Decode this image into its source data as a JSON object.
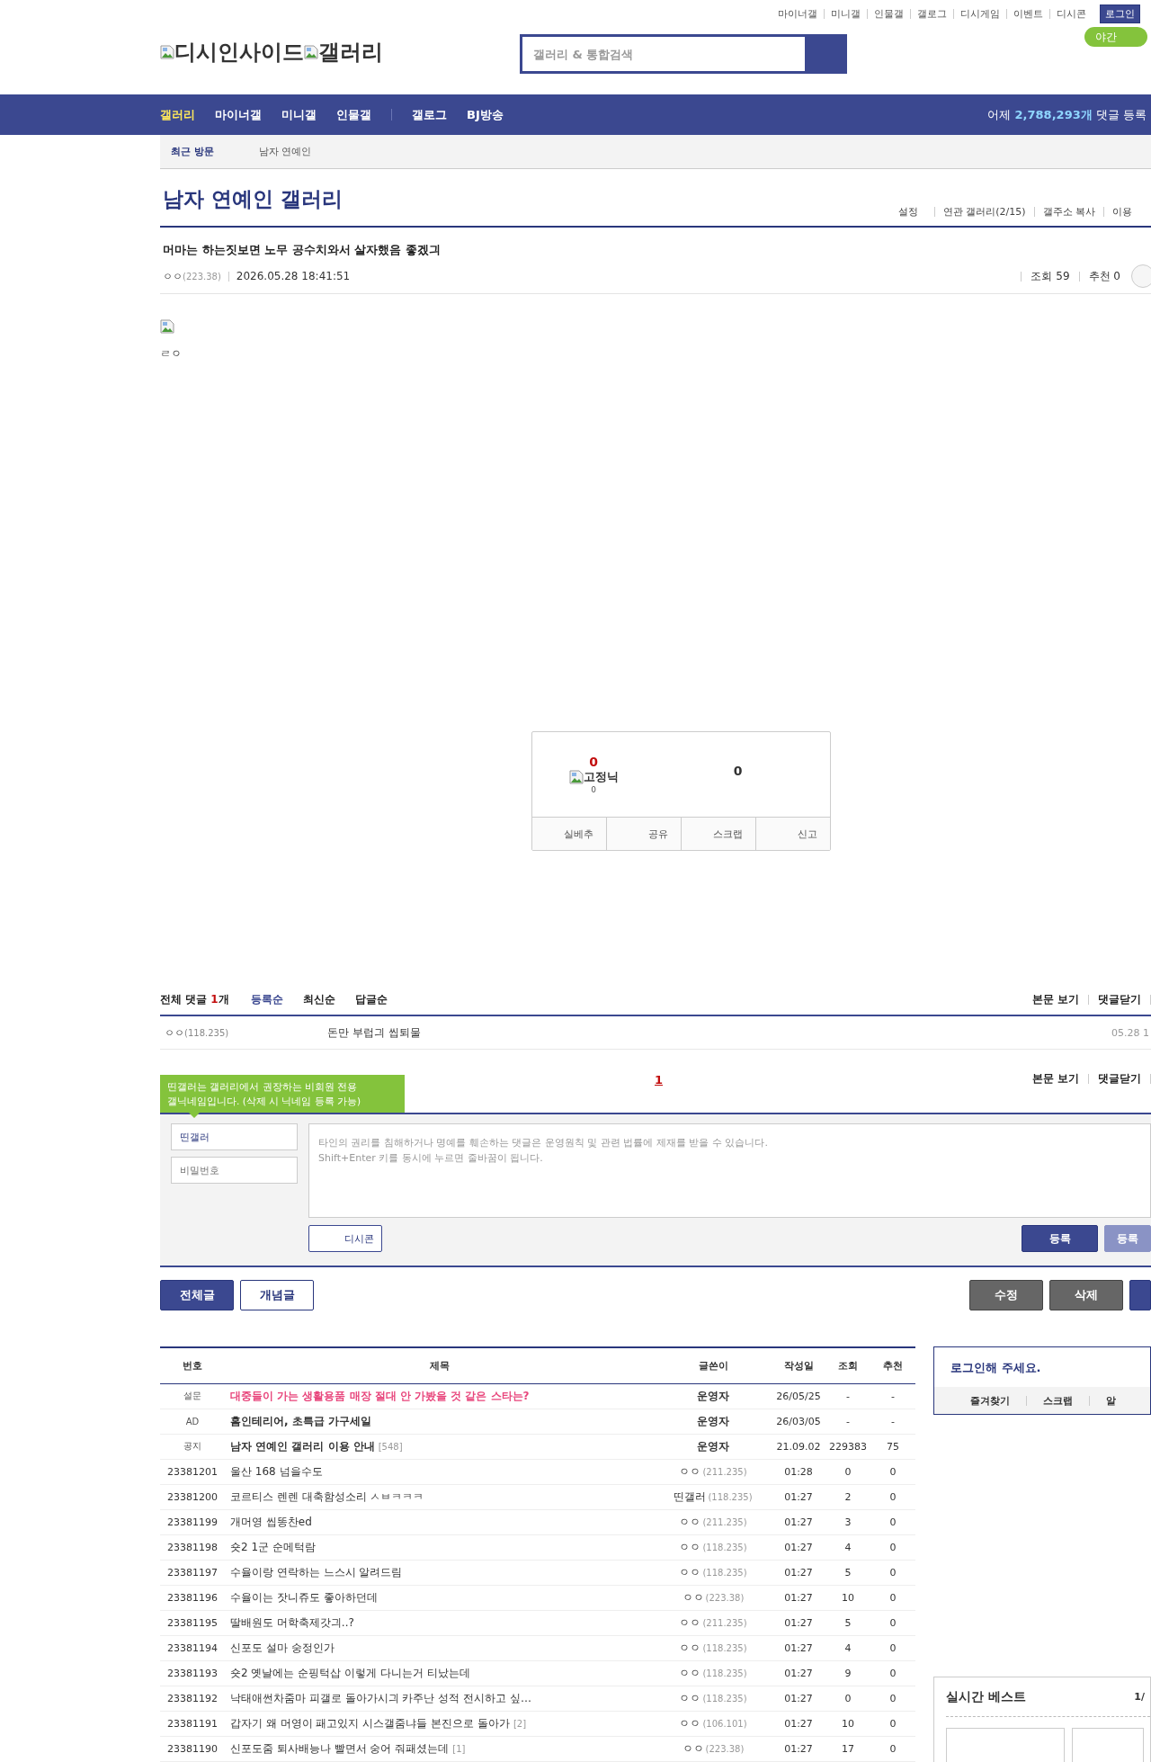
{
  "top_links": [
    "마이너갤",
    "미니갤",
    "인물갤",
    "갤로그",
    "디시게임",
    "이벤트",
    "디시콘"
  ],
  "login_button": "로그인",
  "night_mode_button": "야간",
  "logo": {
    "parts": [
      "디시인사이드",
      "갤러리"
    ]
  },
  "search": {
    "placeholder": "갤러리 & 통합검색"
  },
  "nav": {
    "groups": [
      [
        {
          "label": "갤러리",
          "selected": true
        },
        {
          "label": "마이너갤",
          "selected": false
        },
        {
          "label": "미니갤",
          "selected": false
        },
        {
          "label": "인물갤",
          "selected": false
        }
      ],
      [
        {
          "label": "갤로그",
          "selected": false
        },
        {
          "label": "BJ방송",
          "selected": false
        }
      ]
    ],
    "stats": {
      "prefix": "어제",
      "count": "2,788,293개",
      "suffix": "댓글 등록"
    }
  },
  "recent": {
    "label": "최근 방문",
    "items": [
      "남자 연예인"
    ]
  },
  "gallery": {
    "title": "남자 연예인 갤러리",
    "links": [
      "설정",
      "연관 갤러리(2/15)",
      "갤주소 복사",
      "이용"
    ]
  },
  "post": {
    "title": "머마는 하는짓보면 노무 공수치와서 살자했음 좋겠긔",
    "author": "ㅇㅇ",
    "ip": "(223.38)",
    "date": "2026.05.28 18:41:51",
    "views": "조회 59",
    "recommends": "추천 0",
    "body": "ㄹㅇ"
  },
  "vote": {
    "up_count": "0",
    "fixed_nick_label": "고정닉",
    "fixed_nick_count": "0",
    "down_count": "0",
    "actions": [
      "실베추",
      "공유",
      "스크랩",
      "신고"
    ]
  },
  "comments": {
    "total_label": "전체 댓글",
    "count": "1",
    "count_unit": "개",
    "sorts": [
      {
        "label": "등록순",
        "selected": true
      },
      {
        "label": "최신순",
        "selected": false
      },
      {
        "label": "답글순",
        "selected": false
      }
    ],
    "links": [
      "본문 보기",
      "댓글닫기"
    ],
    "items": [
      {
        "author": "ㅇㅇ",
        "ip": "(118.235)",
        "text": "돈만 부럽긔 씹퇴물",
        "date": "05.28 1"
      }
    ],
    "pages": [
      {
        "label": "1",
        "selected": true
      }
    ],
    "bottom_links": [
      "본문 보기",
      "댓글닫기"
    ]
  },
  "comment_form": {
    "tooltip": "띤갤러는 갤러리에서 권장하는 비회원 전용 갤닉네임입니다. (삭제 시 닉네임 등록 가능)",
    "nickname": "띤갤러",
    "password_placeholder": "비밀번호",
    "text_placeholder": "타인의 권리를 침해하거나 명예를 훼손하는 댓글은 운영원칙 및 관련 법률에 제재를 받을 수 있습니다.\nShift+Enter 키를 동시에 누르면 줄바꿈이 됩니다.",
    "dccon_button": "디시콘",
    "submit_buttons": [
      "등록",
      "등록"
    ]
  },
  "list_buttons": {
    "left": [
      {
        "label": "전체글",
        "selected": true
      },
      {
        "label": "개념글",
        "selected": false
      }
    ],
    "right": [
      "수정",
      "삭제"
    ]
  },
  "table": {
    "columns": [
      "번호",
      "제목",
      "글쓴이",
      "작성일",
      "조회",
      "추천"
    ],
    "rows": [
      {
        "kind": "survey",
        "number": "설문",
        "title": "대중들이 가는 생활용품 매장 절대 안 가봤을 것 같은 스타는?",
        "author": "운영자",
        "date": "26/05/25",
        "views": "-",
        "recommends": "-"
      },
      {
        "kind": "ad",
        "number": "AD",
        "title": "홈인테리어, 초특급 가구세일",
        "author": "운영자",
        "date": "26/03/05",
        "views": "-",
        "recommends": "-"
      },
      {
        "kind": "notice",
        "number": "공지",
        "title": "남자 연예인 갤러리 이용 안내",
        "comment_count": "[548]",
        "author": "운영자",
        "date": "21.09.02",
        "views": "229383",
        "recommends": "75"
      },
      {
        "kind": "post",
        "number": "23381201",
        "title": "울산 168 넘을수도",
        "author": "ㅇㅇ",
        "ip": "(211.235)",
        "date": "01:28",
        "views": "0",
        "recommends": "0"
      },
      {
        "kind": "post",
        "number": "23381200",
        "title": "코르티스 렌렌 대축함성소리 ㅅㅂㅋㅋㅋ",
        "author": "띤갤러",
        "ip": "(118.235)",
        "date": "01:27",
        "views": "2",
        "recommends": "0"
      },
      {
        "kind": "post",
        "number": "23381199",
        "title": "개머영 씹똥찬ed",
        "author": "ㅇㅇ",
        "ip": "(211.235)",
        "date": "01:27",
        "views": "3",
        "recommends": "0"
      },
      {
        "kind": "post",
        "number": "23381198",
        "title": "숏2 1군 순메턱람",
        "author": "ㅇㅇ",
        "ip": "(118.235)",
        "date": "01:27",
        "views": "4",
        "recommends": "0"
      },
      {
        "kind": "post",
        "number": "23381197",
        "title": "수율이랑 연락하는 느스시 알려드림",
        "author": "ㅇㅇ",
        "ip": "(118.235)",
        "date": "01:27",
        "views": "5",
        "recommends": "0"
      },
      {
        "kind": "post",
        "number": "23381196",
        "title": "수율이는 잣니쥬도 좋아하던데",
        "author": "ㅇㅇ",
        "ip": "(223.38)",
        "date": "01:27",
        "views": "10",
        "recommends": "0"
      },
      {
        "kind": "post",
        "number": "23381195",
        "title": "딸배원도 머학축제갓긔..?",
        "author": "ㅇㅇ",
        "ip": "(211.235)",
        "date": "01:27",
        "views": "5",
        "recommends": "0"
      },
      {
        "kind": "post",
        "number": "23381194",
        "title": "신포도 설마 숭정인가",
        "author": "ㅇㅇ",
        "ip": "(118.235)",
        "date": "01:27",
        "views": "4",
        "recommends": "0"
      },
      {
        "kind": "post",
        "number": "23381193",
        "title": "숏2 옛날에는 순핑턱삽 이렇게 다니는거 티났는데",
        "author": "ㅇㅇ",
        "ip": "(118.235)",
        "date": "01:27",
        "views": "9",
        "recommends": "0"
      },
      {
        "kind": "post",
        "number": "23381192",
        "title": "낙태애썬차줌마 피갤로 돌아가시긔 카주난 성적 전시하고 싶…",
        "author": "ㅇㅇ",
        "ip": "(118.235)",
        "date": "01:27",
        "views": "0",
        "recommends": "0"
      },
      {
        "kind": "post",
        "number": "23381191",
        "title": "갑자기 왜 머영이 패고있지 시스갤줌냐들 본진으로 돌아가",
        "reply_count": "[2]",
        "author": "ㅇㅇ",
        "ip": "(106.101)",
        "date": "01:27",
        "views": "10",
        "recommends": "0"
      },
      {
        "kind": "post",
        "number": "23381190",
        "title": "신포도줌 퇴사배능나 빨면서 숭어 줘패셨는데",
        "reply_count": "[1]",
        "author": "ㅇㅇ",
        "ip": "(223.38)",
        "date": "01:27",
        "views": "17",
        "recommends": "0"
      }
    ]
  },
  "side": {
    "login": {
      "message": "로그인해 주세요.",
      "links": [
        "즐겨찾기",
        "스크랩",
        "알"
      ]
    },
    "best": {
      "title": "실시간 베스트",
      "page": "1/"
    }
  }
}
